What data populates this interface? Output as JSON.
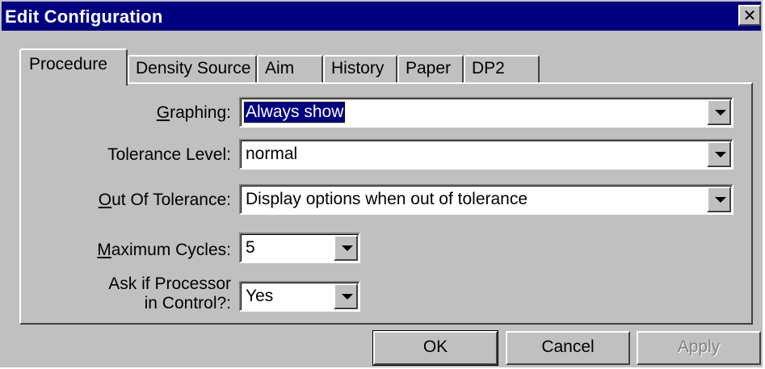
{
  "window": {
    "title": "Edit Configuration",
    "close_label": "✕"
  },
  "tabs": [
    {
      "label": "Procedure",
      "active": true
    },
    {
      "label": "Density Source",
      "active": false
    },
    {
      "label": "Aim",
      "active": false
    },
    {
      "label": "History",
      "active": false
    },
    {
      "label": "Paper",
      "active": false
    },
    {
      "label": "DP2",
      "active": false
    }
  ],
  "fields": {
    "graphing": {
      "label_underline": "G",
      "label_rest": "raphing:",
      "value": "Always show"
    },
    "tolerance_level": {
      "label": "Tolerance Level:",
      "value": "normal"
    },
    "out_of_tolerance": {
      "label_underline": "O",
      "label_rest": "ut Of Tolerance:",
      "value": "Display options when out of tolerance"
    },
    "maximum_cycles": {
      "label_underline": "M",
      "label_rest": "aximum Cycles:",
      "value": "5"
    },
    "processor_in_control": {
      "label_line1": "Ask if Processor",
      "label_line2": "in Control?:",
      "value": "Yes"
    }
  },
  "buttons": {
    "ok": "OK",
    "cancel": "Cancel",
    "apply": "Apply"
  },
  "colors": {
    "titlebar": "#000080",
    "face": "#c0c0c0",
    "selection": "#000080"
  }
}
